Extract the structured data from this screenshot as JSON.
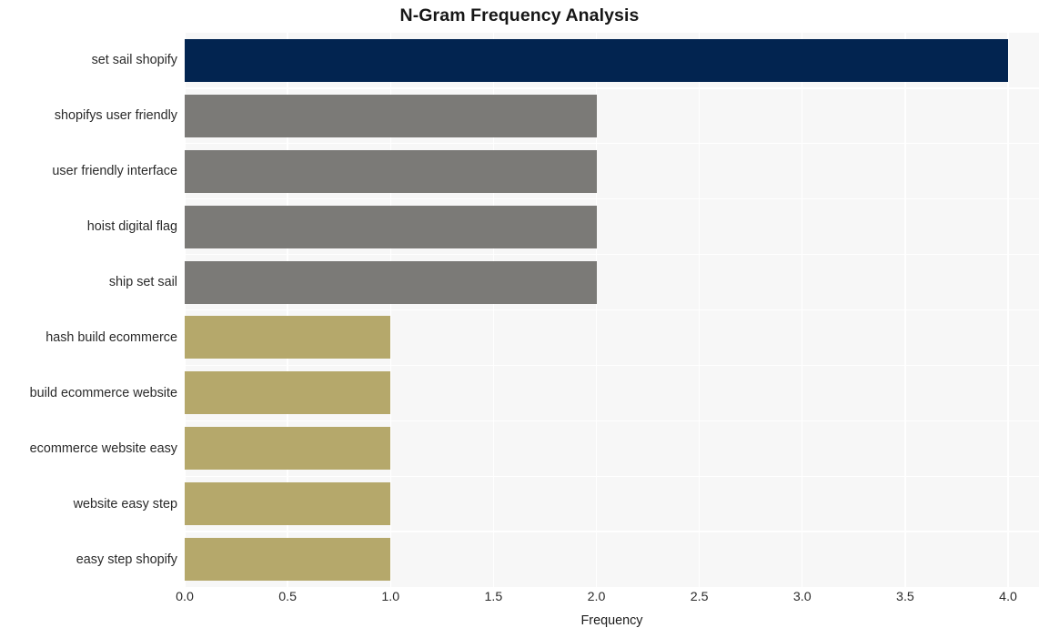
{
  "chart_data": {
    "type": "bar",
    "orientation": "horizontal",
    "title": "N-Gram Frequency Analysis",
    "xlabel": "Frequency",
    "ylabel": "",
    "xlim": [
      0,
      4.15
    ],
    "grid": true,
    "legend": "none",
    "categories": [
      "set sail shopify",
      "shopifys user friendly",
      "user friendly interface",
      "hoist digital flag",
      "ship set sail",
      "hash build ecommerce",
      "build ecommerce website",
      "ecommerce website easy",
      "website easy step",
      "easy step shopify"
    ],
    "values": [
      4.0,
      2.0,
      2.0,
      2.0,
      2.0,
      1.0,
      1.0,
      1.0,
      1.0,
      1.0
    ],
    "bar_colors": [
      "#022450",
      "#7b7a77",
      "#7b7a77",
      "#7b7a77",
      "#7b7a77",
      "#b5a86b",
      "#b5a86b",
      "#b5a86b",
      "#b5a86b",
      "#b5a86b"
    ],
    "xticks": [
      {
        "value": 0.0,
        "label": "0.0"
      },
      {
        "value": 0.5,
        "label": "0.5"
      },
      {
        "value": 1.0,
        "label": "1.0"
      },
      {
        "value": 1.5,
        "label": "1.5"
      },
      {
        "value": 2.0,
        "label": "2.0"
      },
      {
        "value": 2.5,
        "label": "2.5"
      },
      {
        "value": 3.0,
        "label": "3.0"
      },
      {
        "value": 3.5,
        "label": "3.5"
      },
      {
        "value": 4.0,
        "label": "4.0"
      }
    ],
    "colors": {
      "figure_background": "#ffffff",
      "plot_background": "#f7f7f7",
      "gridline": "#ffffff",
      "text": "#2a2a2a",
      "title": "#161616"
    }
  }
}
